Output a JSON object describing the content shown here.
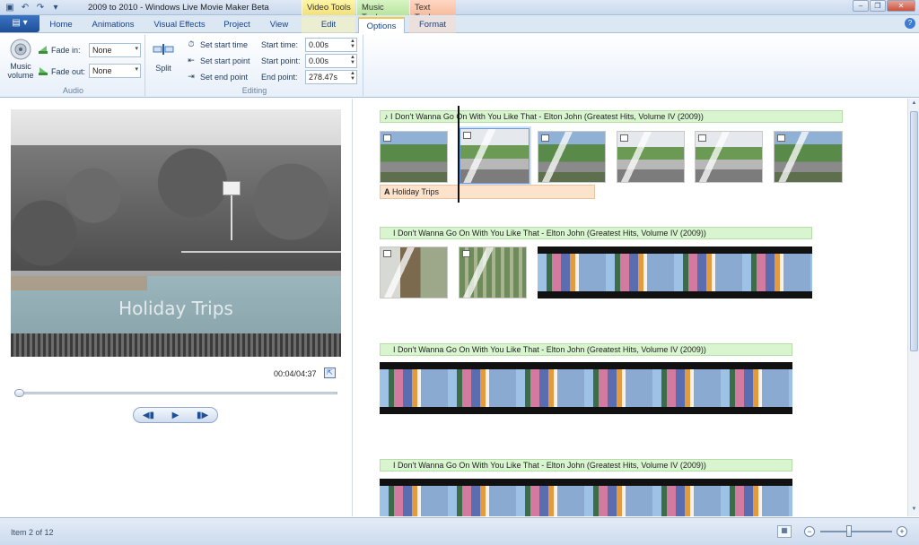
{
  "titlebar": {
    "title": "2009 to 2010 - Windows Live Movie Maker Beta",
    "context_tabs": {
      "video": "Video Tools",
      "music": "Music Tools",
      "text": "Text Tools"
    }
  },
  "tabs": {
    "home": "Home",
    "animations": "Animations",
    "visual_effects": "Visual Effects",
    "project": "Project",
    "view": "View",
    "edit": "Edit",
    "options": "Options",
    "format": "Format",
    "active": "Options"
  },
  "ribbon": {
    "audio": {
      "music_volume": "Music volume",
      "fade_in_label": "Fade in:",
      "fade_in_value": "None",
      "fade_out_label": "Fade out:",
      "fade_out_value": "None",
      "group_label": "Audio"
    },
    "editing": {
      "split": "Split",
      "set_start_time": "Set start time",
      "set_start_point": "Set start point",
      "set_end_point": "Set end point",
      "start_time_label": "Start time:",
      "start_time_value": "0.00s",
      "start_point_label": "Start point:",
      "start_point_value": "0.00s",
      "end_point_label": "End point:",
      "end_point_value": "278.47s",
      "group_label": "Editing"
    }
  },
  "preview": {
    "caption": "Holiday Trips",
    "timecode": "00:04/04:37",
    "seek_progress": 0.014
  },
  "storyboard": {
    "music_track": "I Don't Wanna Go On With You Like That - Elton John (Greatest Hits, Volume IV (2009))",
    "text_caption": "Holiday Trips",
    "music_glyph": "♪",
    "text_glyph": "A"
  },
  "status": {
    "item_text": "Item 2 of 12"
  },
  "icons": {
    "app_menu": "app-menu-icon",
    "save": "save-icon",
    "undo": "undo-icon",
    "redo": "redo-icon",
    "music_volume": "speaker-icon",
    "split": "split-icon",
    "fullscreen": "fullscreen-icon"
  },
  "colors": {
    "video_tools": "#f1e07a",
    "music_tools": "#b8e49e",
    "text_tools": "#f7bc9f",
    "accent": "#1e4f96"
  }
}
